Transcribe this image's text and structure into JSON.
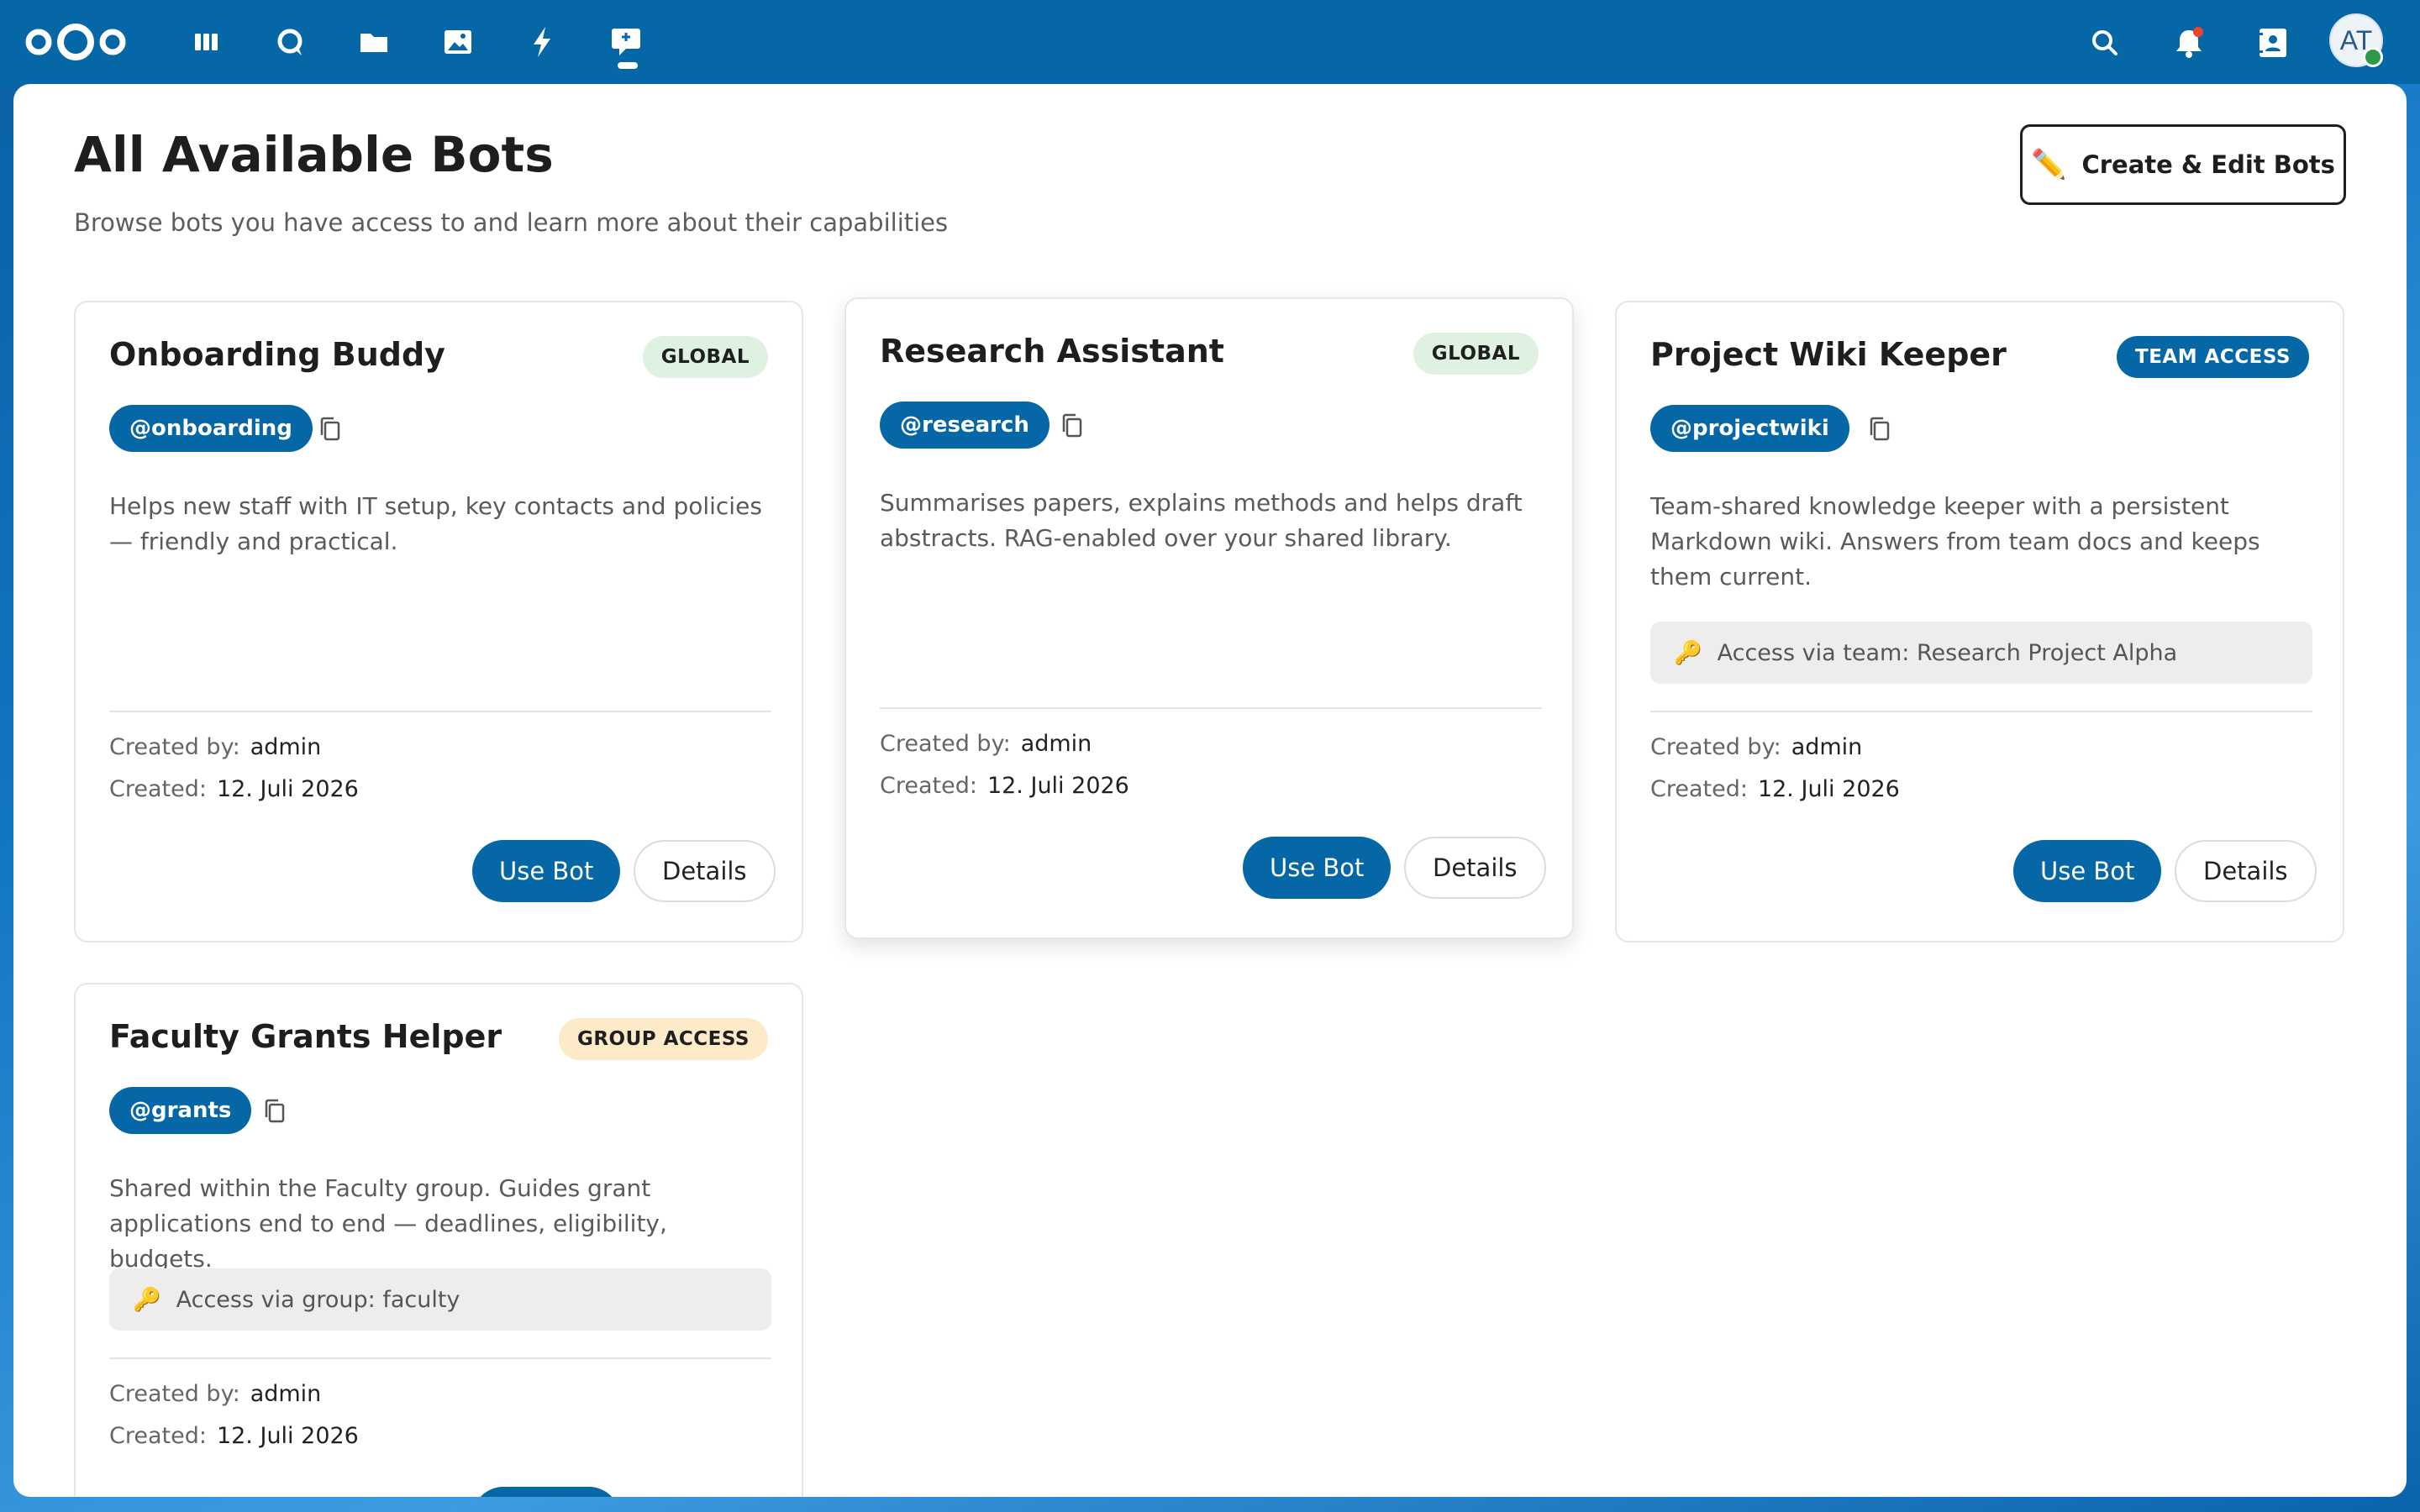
{
  "topbar": {
    "apps": [
      {
        "name": "dashboard-icon"
      },
      {
        "name": "talk-icon"
      },
      {
        "name": "files-icon"
      },
      {
        "name": "photos-icon"
      },
      {
        "name": "activity-icon"
      },
      {
        "name": "bots-icon",
        "active": true
      }
    ],
    "right": [
      "search-icon",
      "notifications-icon",
      "contacts-icon"
    ],
    "avatar_initials": "AT",
    "colors": {
      "bar": "#0567a6",
      "accent": "#0567a6",
      "notification": "#e9462b",
      "status_online": "#2d9a4a"
    }
  },
  "page": {
    "title": "All Available Bots",
    "subtitle": "Browse bots you have access to and learn more about their capabilities",
    "create_button": "Create & Edit Bots",
    "create_icon": "pencil-icon"
  },
  "labels": {
    "created_by": "Created by:",
    "created": "Created:",
    "use_bot": "Use Bot",
    "details": "Details"
  },
  "bots": [
    {
      "name": "Onboarding Buddy",
      "badge": "GLOBAL",
      "handle": "@onboarding",
      "description": "Helps new staff with IT setup, key contacts and policies — friendly and practical.",
      "created_by": "admin",
      "created": "12. Juli 2026"
    },
    {
      "name": "Research Assistant",
      "badge": "GLOBAL",
      "handle": "@research",
      "description": "Summarises papers, explains methods and helps draft abstracts. RAG-enabled over your shared library.",
      "created_by": "admin",
      "created": "12. Juli 2026"
    },
    {
      "name": "Project Wiki Keeper",
      "badge": "TEAM ACCESS",
      "handle": "@projectwiki",
      "description": "Team-shared knowledge keeper with a persistent Markdown wiki. Answers from team docs and keeps them current.",
      "access": "Access via team: Research Project Alpha",
      "created_by": "admin",
      "created": "12. Juli 2026"
    },
    {
      "name": "Faculty Grants Helper",
      "badge": "GROUP ACCESS",
      "handle": "@grants",
      "description": "Shared within the Faculty group. Guides grant applications end to end — deadlines, eligibility, budgets.",
      "access": "Access via group: faculty",
      "created_by": "admin",
      "created": "12. Juli 2026"
    }
  ]
}
